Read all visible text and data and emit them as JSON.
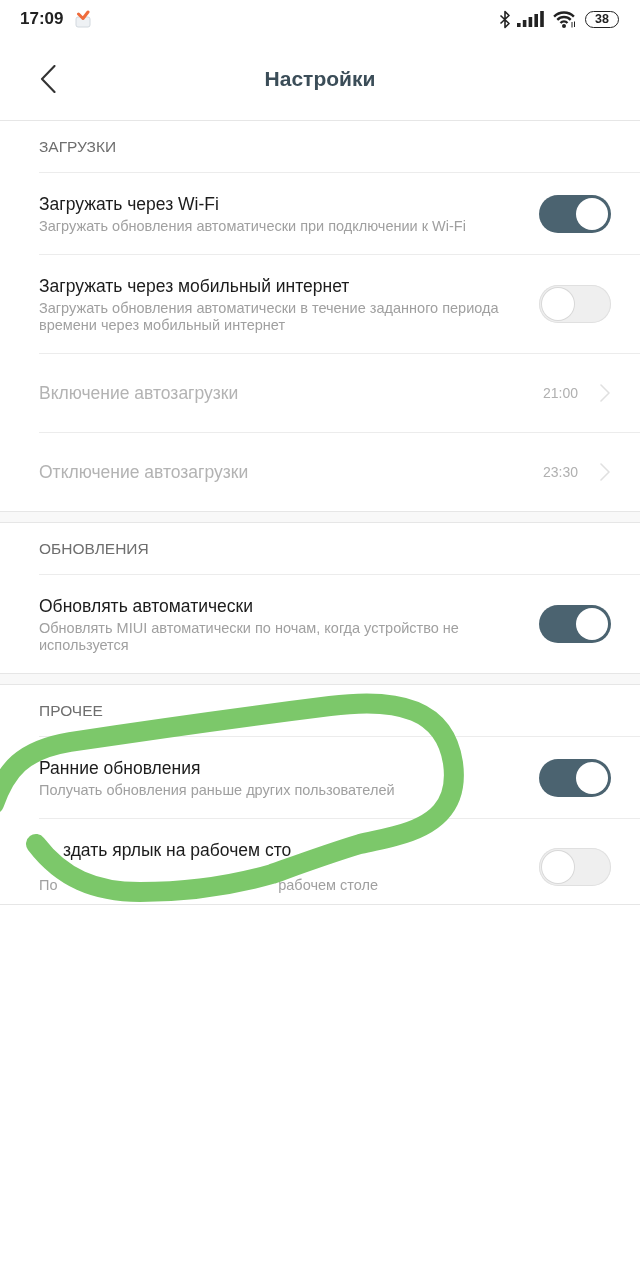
{
  "status_bar": {
    "time": "17:09",
    "battery": "38"
  },
  "header": {
    "title": "Настройки"
  },
  "sections": [
    {
      "title": "ЗАГРУЗКИ",
      "items": [
        {
          "kind": "toggle",
          "title": "Загружать через Wi-Fi",
          "subtitle": "Загружать обновления автоматически при подключении к Wi-Fi",
          "on": true,
          "disabled": false
        },
        {
          "kind": "toggle",
          "title": "Загружать через мобильный интернет",
          "subtitle": "Загружать обновления автоматически в течение заданного периода времени через мобильный интернет",
          "on": false,
          "disabled": false
        },
        {
          "kind": "value",
          "title": "Включение автозагрузки",
          "value": "21:00",
          "disabled": true
        },
        {
          "kind": "value",
          "title": "Отключение автозагрузки",
          "value": "23:30",
          "disabled": true
        }
      ]
    },
    {
      "title": "ОБНОВЛЕНИЯ",
      "items": [
        {
          "kind": "toggle",
          "title": "Обновлять автоматически",
          "subtitle": "Обновлять MIUI автоматически по ночам, когда устройство не используется",
          "on": true,
          "disabled": false
        }
      ]
    },
    {
      "title": "ПРОЧЕЕ",
      "annotation": {
        "kind": "freehand_loop"
      },
      "items": [
        {
          "kind": "toggle",
          "title": "Ранние обновления",
          "subtitle": "Получать обновления раньше других пользователей",
          "on": true,
          "disabled": false
        },
        {
          "kind": "toggle",
          "title": "здать ярлык на рабочем сто",
          "subtitle_parts": [
            "По",
            "рабочем столе"
          ],
          "obscured": true,
          "on": false,
          "disabled": false
        }
      ]
    }
  ]
}
